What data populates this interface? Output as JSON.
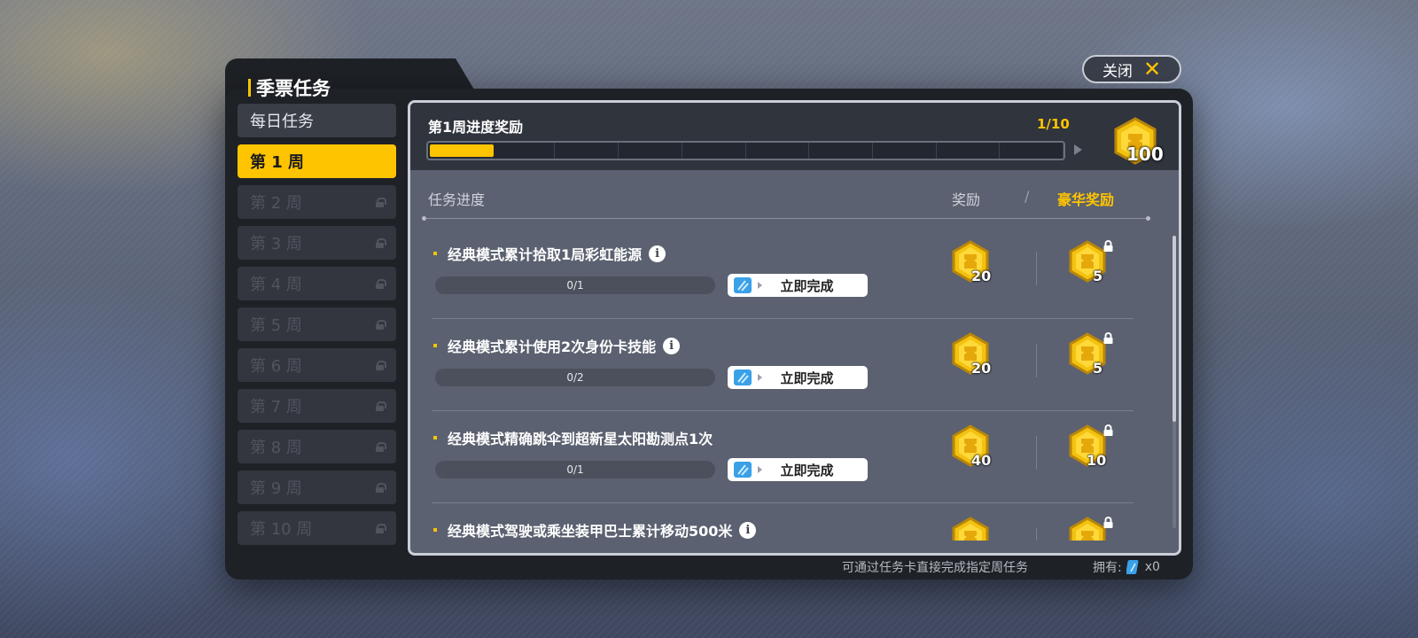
{
  "header": {
    "title": "季票任务",
    "close_label": "关闭"
  },
  "sidebar": {
    "items": [
      {
        "label": "每日任务",
        "state": "normal"
      },
      {
        "label": "第 1 周",
        "state": "active"
      },
      {
        "label": "第 2 周",
        "state": "locked"
      },
      {
        "label": "第 3 周",
        "state": "locked"
      },
      {
        "label": "第 4 周",
        "state": "locked"
      },
      {
        "label": "第 5 周",
        "state": "locked"
      },
      {
        "label": "第 6 周",
        "state": "locked"
      },
      {
        "label": "第 7 周",
        "state": "locked"
      },
      {
        "label": "第 8 周",
        "state": "locked"
      },
      {
        "label": "第 9 周",
        "state": "locked"
      },
      {
        "label": "第 10 周",
        "state": "locked"
      }
    ]
  },
  "progress": {
    "title": "第1周进度奖励",
    "count": "1/10",
    "progress_fraction": 0.1,
    "reward_amount": "100",
    "reward_icon": "gold-coin-icon"
  },
  "columns": {
    "task": "任务进度",
    "reward": "奖励",
    "slash": "/",
    "deluxe": "豪华奖励"
  },
  "tasks": [
    {
      "title": "经典模式累计拾取1局彩虹能源",
      "progress": "0/1",
      "button": "立即完成",
      "reward": "20",
      "deluxe": "5",
      "has_info": true
    },
    {
      "title": "经典模式累计使用2次身份卡技能",
      "progress": "0/2",
      "button": "立即完成",
      "reward": "20",
      "deluxe": "5",
      "has_info": true
    },
    {
      "title": "经典模式精确跳伞到超新星太阳勘测点1次",
      "progress": "0/1",
      "button": "立即完成",
      "reward": "40",
      "deluxe": "10",
      "has_info": false
    },
    {
      "title": "经典模式驾驶或乘坐装甲巴士累计移动500米",
      "progress": "",
      "button": "",
      "reward": "",
      "deluxe": "",
      "has_info": true
    }
  ],
  "footer": {
    "hint": "可通过任务卡直接完成指定周任务",
    "own_label": "拥有:",
    "own_count": "x0"
  },
  "colors": {
    "accent": "#ffc400",
    "panel": "#5b6170",
    "dialog": "#1e2126"
  }
}
